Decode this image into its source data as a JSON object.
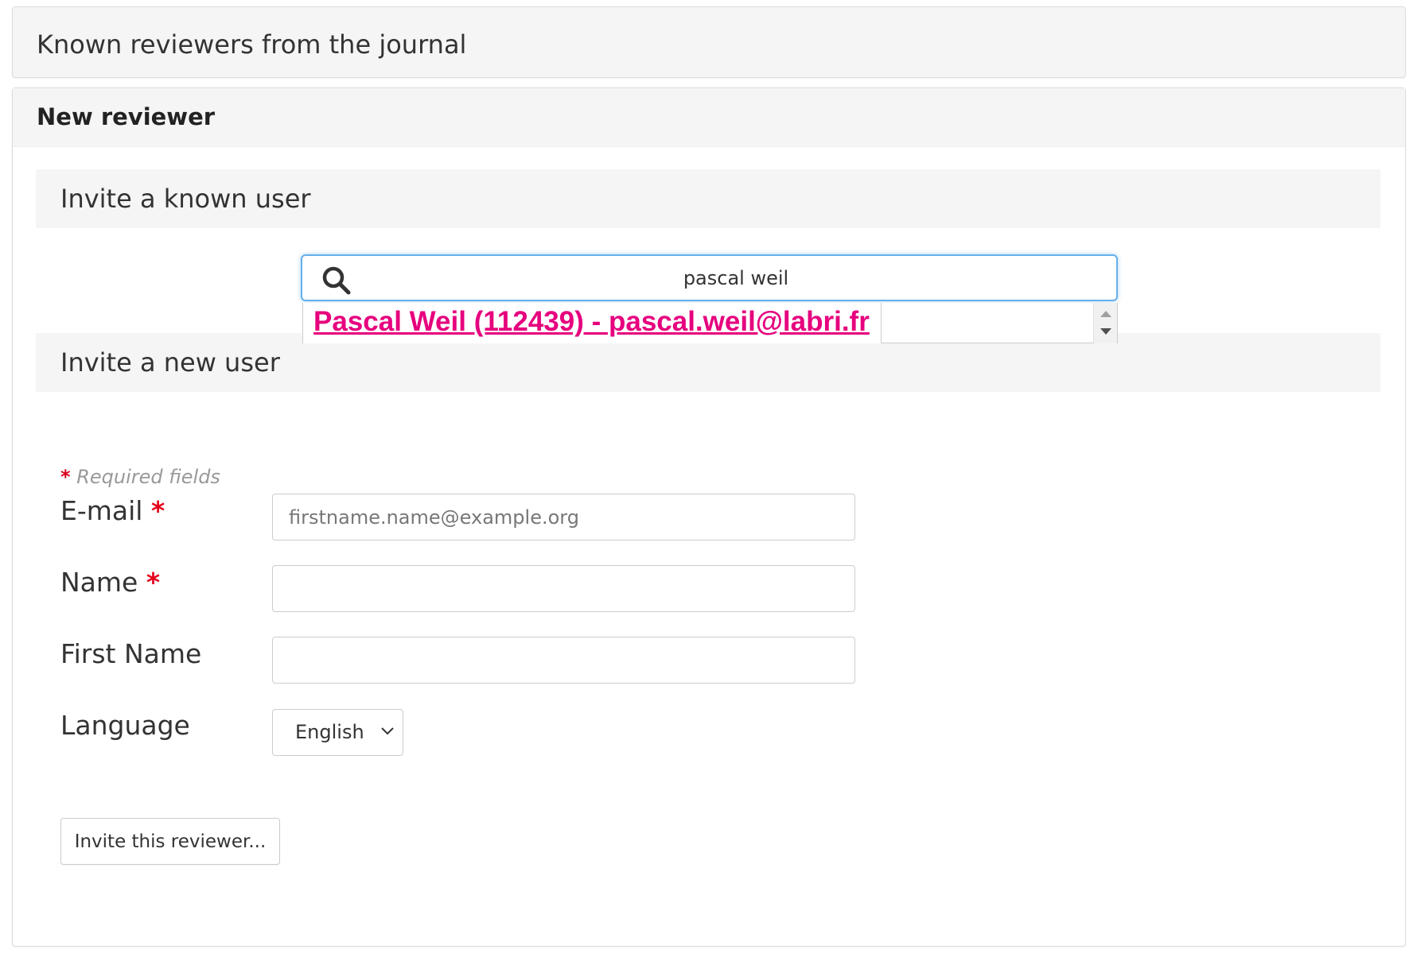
{
  "known_reviewers": {
    "title": "Known reviewers from the journal"
  },
  "new_reviewer": {
    "title": "New reviewer",
    "invite_known": {
      "title": "Invite a known user",
      "search": {
        "icon": "search-icon",
        "value": "pascal weil",
        "suggestions": [
          "Pascal Weil (112439) - pascal.weil@labri.fr"
        ]
      }
    },
    "invite_new": {
      "title": "Invite a new user",
      "required_star": "*",
      "required_text": "Required fields",
      "fields": {
        "email": {
          "label": "E-mail",
          "required": "*",
          "placeholder": "firstname.name@example.org",
          "value": ""
        },
        "name": {
          "label": "Name",
          "required": "*",
          "value": ""
        },
        "first_name": {
          "label": "First Name",
          "value": ""
        },
        "language": {
          "label": "Language",
          "selected": "English",
          "icon": "chevron-down-icon"
        }
      },
      "submit_label": "Invite this reviewer..."
    }
  },
  "colors": {
    "accent_link": "#e6007e",
    "required_star": "#e4001b",
    "focus_border": "#66afe9",
    "panel_header_bg": "#f5f5f5"
  }
}
